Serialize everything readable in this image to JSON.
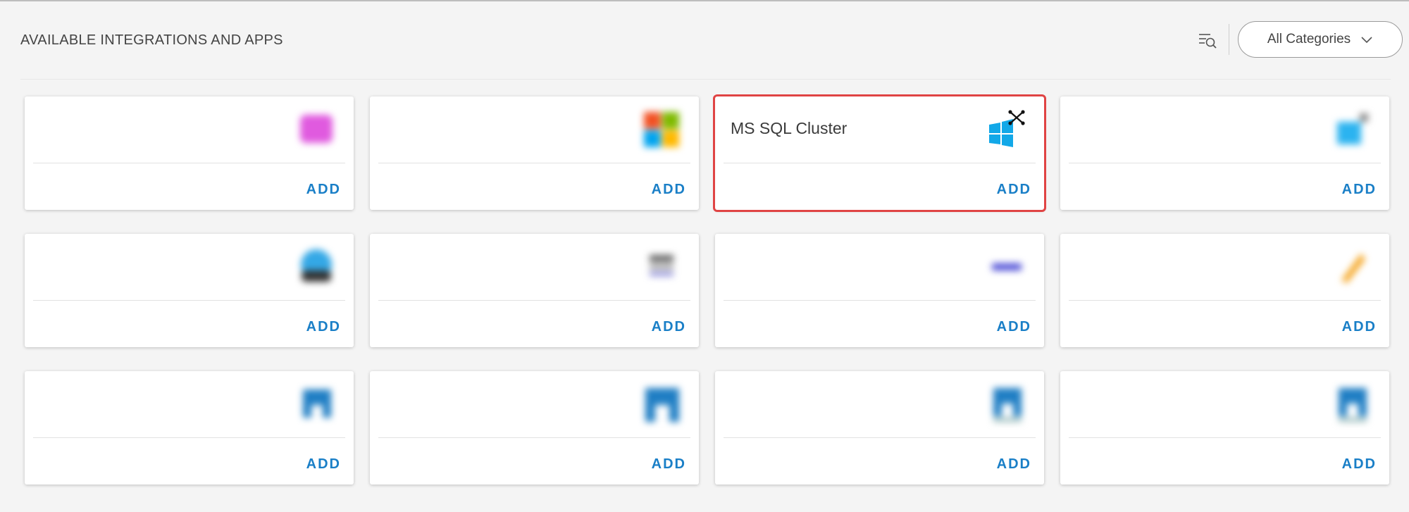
{
  "header": {
    "title": "AVAILABLE INTEGRATIONS AND APPS",
    "filter_icon": "search-list-icon",
    "category_select": {
      "value": "All Categories",
      "icon": "chevron-down-icon"
    }
  },
  "add_label": "ADD",
  "accent_color": "#1a7fc7",
  "selection_color": "#e04444",
  "cards": [
    {
      "name": "",
      "logo": "pink-app-logo",
      "blurred": true
    },
    {
      "name": "",
      "logo": "microsoft-logo",
      "blurred": true
    },
    {
      "name": "MS SQL Cluster",
      "logo": "windows-cluster-logo",
      "blurred": false,
      "selected": true
    },
    {
      "name": "",
      "logo": "windows-logo",
      "blurred": true
    },
    {
      "name": "",
      "logo": "blue-globe-logo",
      "blurred": true
    },
    {
      "name": "",
      "logo": "grey-device-logo",
      "blurred": true
    },
    {
      "name": "",
      "logo": "nec-logo",
      "blurred": true
    },
    {
      "name": "",
      "logo": "orange-feather-logo",
      "blurred": true
    },
    {
      "name": "",
      "logo": "netapp-logo",
      "blurred": true
    },
    {
      "name": "",
      "logo": "netapp-logo",
      "blurred": true
    },
    {
      "name": "",
      "logo": "netapp-logo",
      "blurred": true
    },
    {
      "name": "",
      "logo": "netapp-logo",
      "blurred": true
    }
  ]
}
